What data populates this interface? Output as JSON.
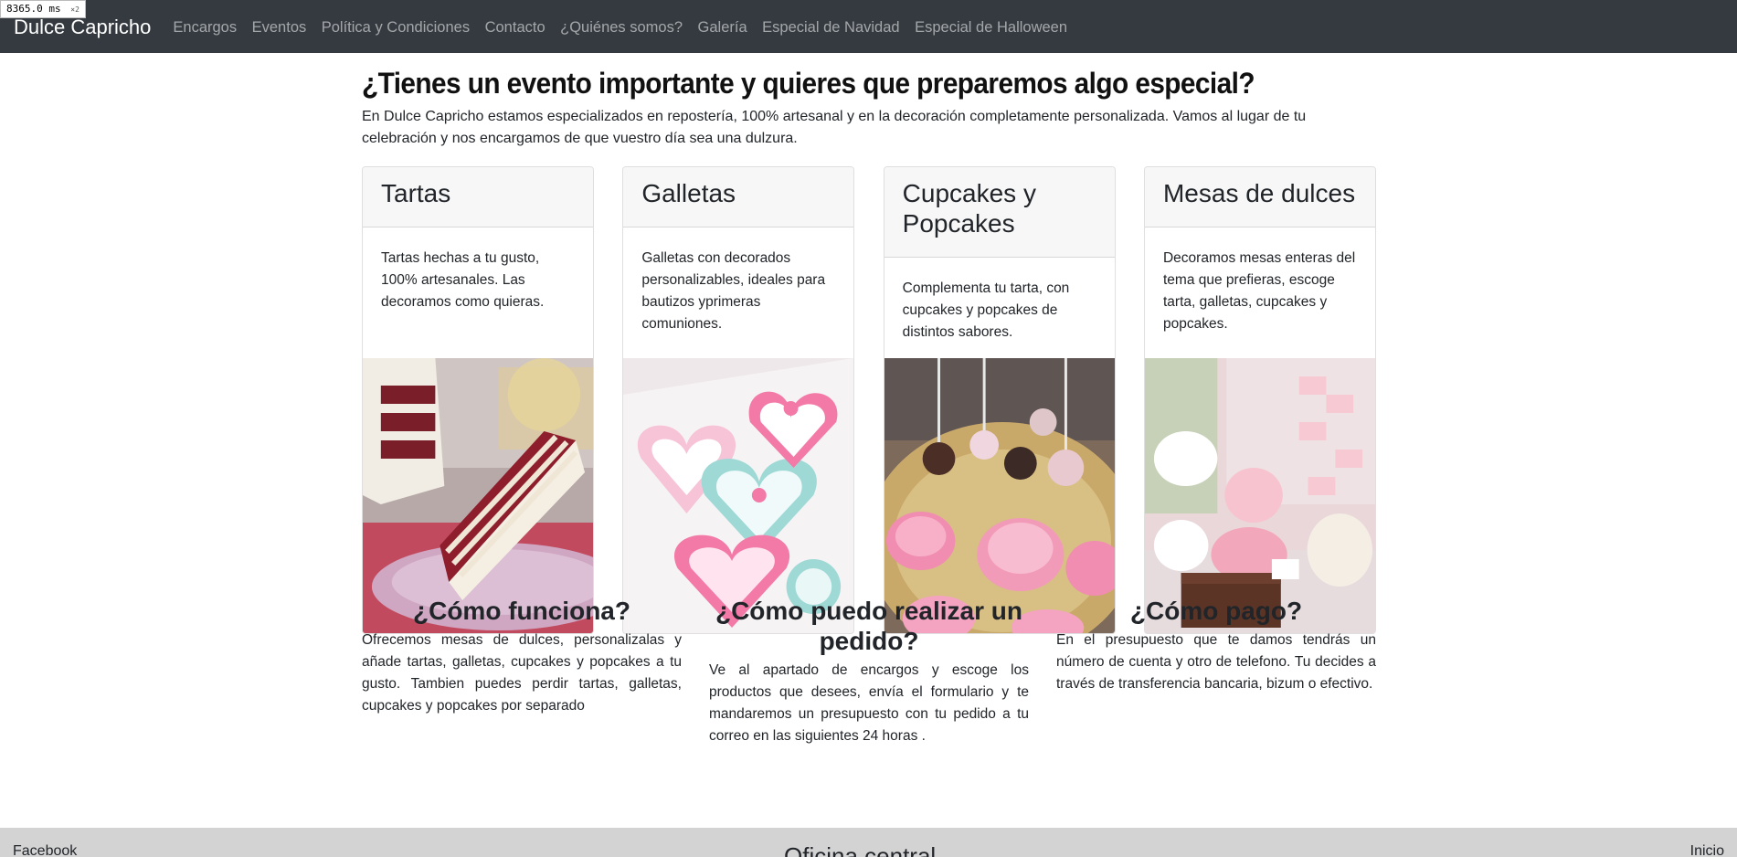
{
  "debug": {
    "timing": "8365.0",
    "unit": "ms",
    "multiplier": "×2"
  },
  "navbar": {
    "brand": "Dulce Capricho",
    "links": [
      "Encargos",
      "Eventos",
      "Política y Condiciones",
      "Contacto",
      "¿Quiénes somos?",
      "Galería",
      "Especial de Navidad",
      "Especial de Halloween"
    ]
  },
  "main": {
    "headline": "¿Tienes un evento importante y quieres que preparemos algo especial?",
    "intro": "En Dulce Capricho estamos especializados en repostería, 100% artesanal y en la decoración completamente personalizada. Vamos al lugar de tu celebración y nos encargamos de que vuestro día sea una dulzura."
  },
  "cards": [
    {
      "title": "Tartas",
      "text": "Tartas hechas a tu gusto, 100% artesanales. Las decoramos como quieras.",
      "image": "red-velvet-cake-slice-photo"
    },
    {
      "title": "Galletas",
      "text": "Galletas con decorados personalizables, ideales para bautizos yprimeras comuniones.",
      "image": "decorated-heart-cookies-photo"
    },
    {
      "title": "Cupcakes y Popcakes",
      "text": "Complementa tu tarta, con cupcakes y popcakes de distintos sabores.",
      "image": "cupcakes-and-cakepops-photo"
    },
    {
      "title": "Mesas de dulces",
      "text": "Decoramos mesas enteras del tema que prefieras, escoge tarta, galletas, cupcakes y popcakes.",
      "image": "candy-table-photo"
    }
  ],
  "info": [
    {
      "title": "¿Cómo funciona?",
      "text": "Ofrecemos mesas de dulces, personalizalas y añade tartas, galletas, cupcakes y popcakes a tu gusto. Tambien puedes perdir tartas, galletas, cupcakes y popcakes por separado"
    },
    {
      "title": "¿Cómo puedo realizar un pedido?",
      "text": "Ve al apartado de encargos y escoge los productos que desees, envía el formulario y te mandaremos un presupuesto con tu pedido a tu correo en las siguientes 24 horas ."
    },
    {
      "title": "¿Cómo pago?",
      "text": "En el presupuesto que te damos tendrás un número de cuenta y otro de telefono. Tu decides a través de transferencia bancaria, bizum o efectivo."
    }
  ],
  "footer": {
    "left": "Facebook",
    "center": "Oficina central",
    "right": "Inicio"
  },
  "colors": {
    "navbar_bg": "#343a40",
    "footer_bg": "#d3d3d3",
    "card_header_bg": "#f7f7f7"
  }
}
